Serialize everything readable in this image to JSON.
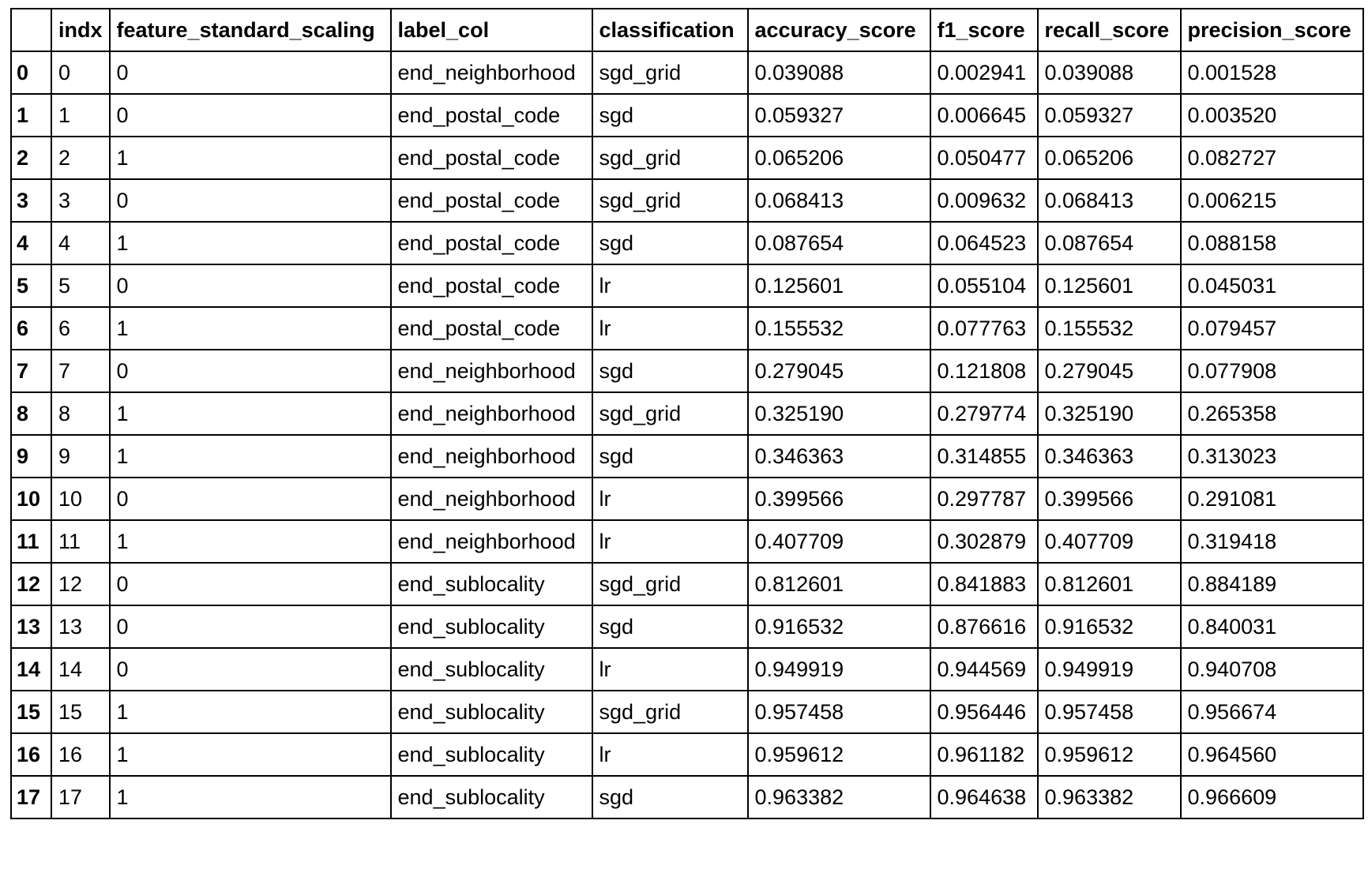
{
  "table": {
    "index_header": "",
    "columns": [
      "indx",
      "feature_standard_scaling",
      "label_col",
      "classification",
      "accuracy_score",
      "f1_score",
      "recall_score",
      "precision_score"
    ],
    "rows": [
      {
        "index": "0",
        "cells": [
          "0",
          "0",
          "end_neighborhood",
          "sgd_grid",
          "0.039088",
          "0.002941",
          "0.039088",
          "0.001528"
        ]
      },
      {
        "index": "1",
        "cells": [
          "1",
          "0",
          "end_postal_code",
          "sgd",
          "0.059327",
          "0.006645",
          "0.059327",
          "0.003520"
        ]
      },
      {
        "index": "2",
        "cells": [
          "2",
          "1",
          "end_postal_code",
          "sgd_grid",
          "0.065206",
          "0.050477",
          "0.065206",
          "0.082727"
        ]
      },
      {
        "index": "3",
        "cells": [
          "3",
          "0",
          "end_postal_code",
          "sgd_grid",
          "0.068413",
          "0.009632",
          "0.068413",
          "0.006215"
        ]
      },
      {
        "index": "4",
        "cells": [
          "4",
          "1",
          "end_postal_code",
          "sgd",
          "0.087654",
          "0.064523",
          "0.087654",
          "0.088158"
        ]
      },
      {
        "index": "5",
        "cells": [
          "5",
          "0",
          "end_postal_code",
          "lr",
          "0.125601",
          "0.055104",
          "0.125601",
          "0.045031"
        ]
      },
      {
        "index": "6",
        "cells": [
          "6",
          "1",
          "end_postal_code",
          "lr",
          "0.155532",
          "0.077763",
          "0.155532",
          "0.079457"
        ]
      },
      {
        "index": "7",
        "cells": [
          "7",
          "0",
          "end_neighborhood",
          "sgd",
          "0.279045",
          "0.121808",
          "0.279045",
          "0.077908"
        ]
      },
      {
        "index": "8",
        "cells": [
          "8",
          "1",
          "end_neighborhood",
          "sgd_grid",
          "0.325190",
          "0.279774",
          "0.325190",
          "0.265358"
        ]
      },
      {
        "index": "9",
        "cells": [
          "9",
          "1",
          "end_neighborhood",
          "sgd",
          "0.346363",
          "0.314855",
          "0.346363",
          "0.313023"
        ]
      },
      {
        "index": "10",
        "cells": [
          "10",
          "0",
          "end_neighborhood",
          "lr",
          "0.399566",
          "0.297787",
          "0.399566",
          "0.291081"
        ]
      },
      {
        "index": "11",
        "cells": [
          "11",
          "1",
          "end_neighborhood",
          "lr",
          "0.407709",
          "0.302879",
          "0.407709",
          "0.319418"
        ]
      },
      {
        "index": "12",
        "cells": [
          "12",
          "0",
          "end_sublocality",
          "sgd_grid",
          "0.812601",
          "0.841883",
          "0.812601",
          "0.884189"
        ]
      },
      {
        "index": "13",
        "cells": [
          "13",
          "0",
          "end_sublocality",
          "sgd",
          "0.916532",
          "0.876616",
          "0.916532",
          "0.840031"
        ]
      },
      {
        "index": "14",
        "cells": [
          "14",
          "0",
          "end_sublocality",
          "lr",
          "0.949919",
          "0.944569",
          "0.949919",
          "0.940708"
        ]
      },
      {
        "index": "15",
        "cells": [
          "15",
          "1",
          "end_sublocality",
          "sgd_grid",
          "0.957458",
          "0.956446",
          "0.957458",
          "0.956674"
        ]
      },
      {
        "index": "16",
        "cells": [
          "16",
          "1",
          "end_sublocality",
          "lr",
          "0.959612",
          "0.961182",
          "0.959612",
          "0.964560"
        ]
      },
      {
        "index": "17",
        "cells": [
          "17",
          "1",
          "end_sublocality",
          "sgd",
          "0.963382",
          "0.964638",
          "0.963382",
          "0.966609"
        ]
      }
    ]
  }
}
